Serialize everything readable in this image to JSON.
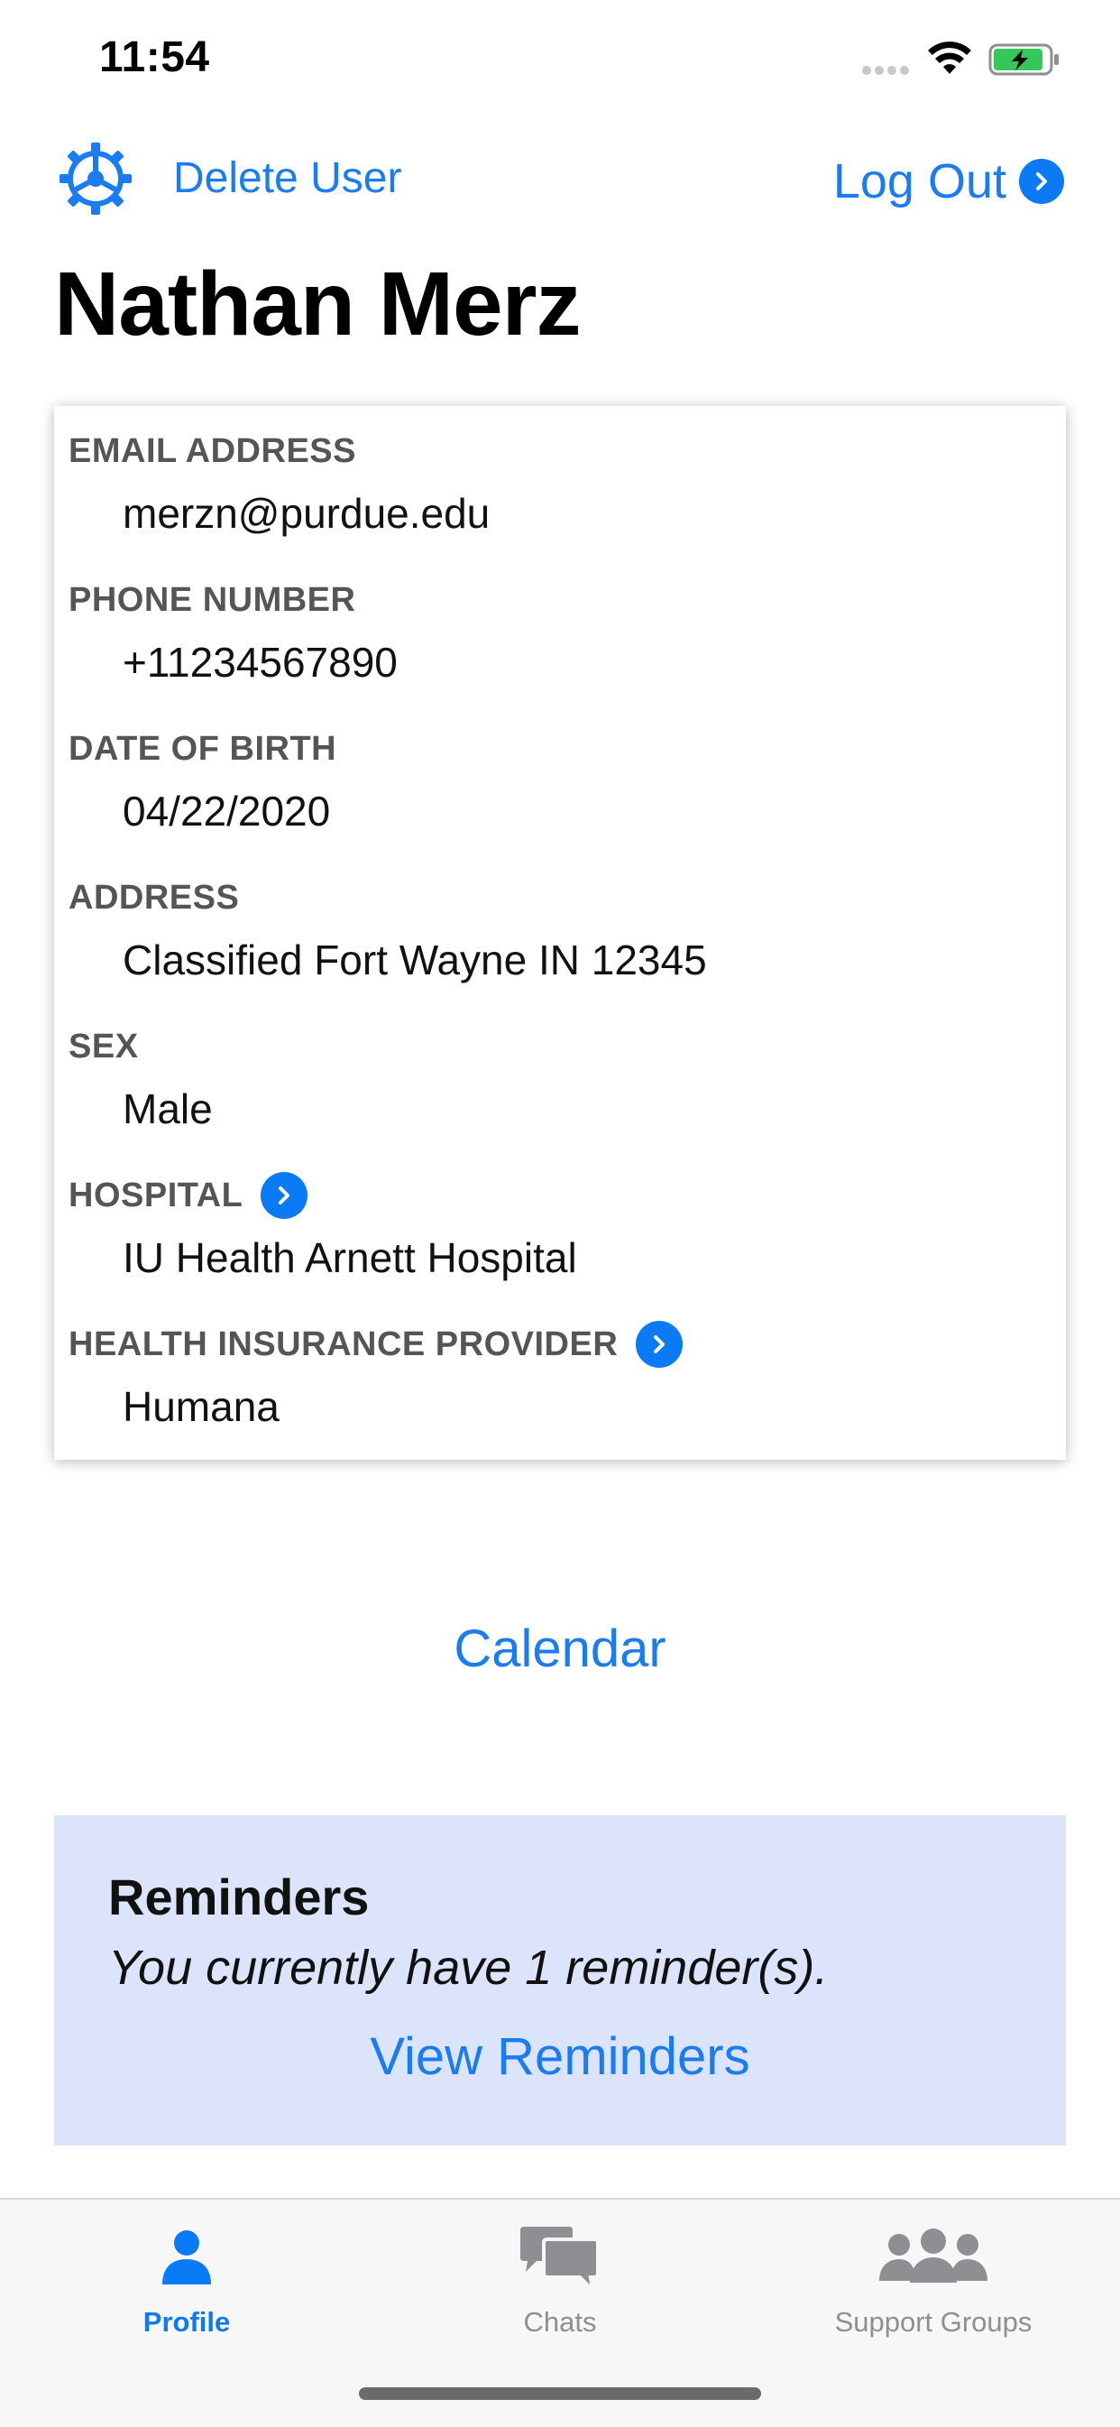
{
  "status_bar": {
    "time": "11:54",
    "icons": [
      "signal-dots-icon",
      "wifi-icon",
      "battery-charging-icon"
    ]
  },
  "header": {
    "settings_icon": "gear-icon",
    "delete_user_label": "Delete User",
    "log_out_label": "Log Out",
    "log_out_icon": "chevron-right-circle-icon",
    "user_name": "Nathan Merz"
  },
  "profile": {
    "fields": [
      {
        "label": "EMAIL ADDRESS",
        "value": "merzn@purdue.edu",
        "link": false
      },
      {
        "label": "PHONE NUMBER",
        "value": "+11234567890",
        "link": false
      },
      {
        "label": "DATE OF BIRTH",
        "value": "04/22/2020",
        "link": false
      },
      {
        "label": "ADDRESS",
        "value": "Classified Fort Wayne IN 12345",
        "link": false
      },
      {
        "label": "SEX",
        "value": "Male",
        "link": false
      },
      {
        "label": "HOSPITAL",
        "value": "IU Health Arnett Hospital",
        "link": true
      },
      {
        "label": "HEALTH INSURANCE PROVIDER",
        "value": "Humana",
        "link": true
      }
    ]
  },
  "calendar_label": "Calendar",
  "reminders": {
    "title": "Reminders",
    "text": "You currently have 1 reminder(s).",
    "view_label": "View Reminders"
  },
  "tabbar": {
    "tabs": [
      {
        "label": "Profile",
        "icon": "person-icon",
        "active": true
      },
      {
        "label": "Chats",
        "icon": "chat-bubbles-icon",
        "active": false
      },
      {
        "label": "Support Groups",
        "icon": "group-icon",
        "active": false
      }
    ]
  },
  "colors": {
    "accent": "#1a7cf0",
    "reminders_bg": "#dce4fb",
    "label_gray": "#555555",
    "tab_inactive": "#8e8e93"
  }
}
